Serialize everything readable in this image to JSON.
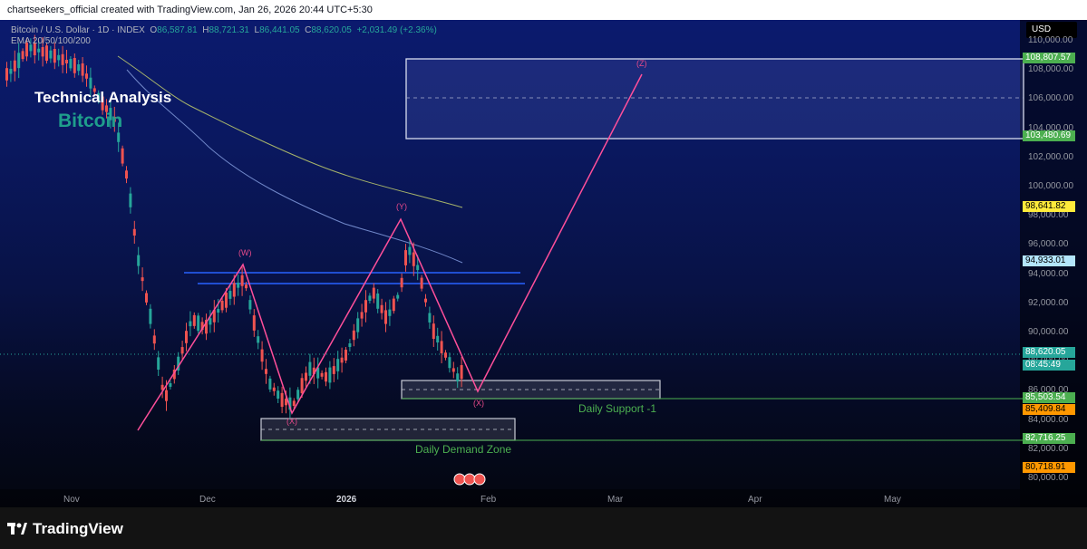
{
  "header": {
    "title": "chartseekers_official created with TradingView.com, Jan 26, 2026 20:44 UTC+5:30"
  },
  "legend": {
    "symbol": "Bitcoin / U.S. Dollar · 1D · INDEX",
    "open_label": "O",
    "open": "86,587.81",
    "high_label": "H",
    "high": "88,721.31",
    "low_label": "L",
    "low": "86,441.05",
    "close_label": "C",
    "close": "88,620.05",
    "change": "+2,031.49 (+2.36%)",
    "indicator": "EMA 20/50/100/200"
  },
  "overlay": {
    "title": "Technical Analysis",
    "subtitle": "Bitcoin"
  },
  "currency": "USD",
  "price_axis": [
    {
      "label": "110,000.00",
      "value": 110000
    },
    {
      "label": "108,000.00",
      "value": 108000
    },
    {
      "label": "106,000.00",
      "value": 106000
    },
    {
      "label": "104,000.00",
      "value": 104000
    },
    {
      "label": "102,000.00",
      "value": 102000
    },
    {
      "label": "100,000.00",
      "value": 100000
    },
    {
      "label": "98,000.00",
      "value": 98000
    },
    {
      "label": "96,000.00",
      "value": 96000
    },
    {
      "label": "94,000.00",
      "value": 94000
    },
    {
      "label": "92,000.00",
      "value": 92000
    },
    {
      "label": "90,000.00",
      "value": 90000
    },
    {
      "label": "88,000.00",
      "value": 88000
    },
    {
      "label": "86,000.00",
      "value": 86000
    },
    {
      "label": "84,000.00",
      "value": 84000
    },
    {
      "label": "82,000.00",
      "value": 82000
    },
    {
      "label": "80,000.00",
      "value": 80000
    }
  ],
  "price_tags": [
    {
      "label": "108,807.57",
      "value": 108807.57,
      "bg": "#4caf50",
      "fg": "#ffffff"
    },
    {
      "label": "103,480.69",
      "value": 103480.69,
      "bg": "#4caf50",
      "fg": "#ffffff"
    },
    {
      "label": "98,641.82",
      "value": 98641.82,
      "bg": "#ffeb3b",
      "fg": "#000000"
    },
    {
      "label": "94,933.01",
      "value": 94933.01,
      "bg": "#b3e5fc",
      "fg": "#000000"
    },
    {
      "label": "88,620.05",
      "value": 88620.05,
      "bg": "#26a69a",
      "fg": "#ffffff"
    },
    {
      "label": "08:45:49",
      "value": 87770,
      "bg": "#26a69a",
      "fg": "#ffffff"
    },
    {
      "label": "85,503.54",
      "value": 85503.54,
      "bg": "#4caf50",
      "fg": "#ffffff"
    },
    {
      "label": "85,409.84",
      "value": 84730,
      "bg": "#ff9800",
      "fg": "#000000"
    },
    {
      "label": "82,716.25",
      "value": 82716.25,
      "bg": "#4caf50",
      "fg": "#ffffff"
    },
    {
      "label": "80,718.91",
      "value": 80718.91,
      "bg": "#ff9800",
      "fg": "#000000"
    }
  ],
  "time_axis": [
    {
      "label": "Nov",
      "bold": false
    },
    {
      "label": "Dec",
      "bold": false
    },
    {
      "label": "2026",
      "bold": true
    },
    {
      "label": "Feb",
      "bold": false
    },
    {
      "label": "Mar",
      "bold": false
    },
    {
      "label": "Apr",
      "bold": false
    },
    {
      "label": "May",
      "bold": false
    }
  ],
  "annotations": {
    "daily_support": "Daily Support -1",
    "daily_demand": "Daily Demand Zone",
    "waves": [
      "W",
      "X",
      "Y",
      "X",
      "Z"
    ]
  },
  "colors": {
    "up": "#26a69a",
    "down": "#ef5350",
    "zone_line": "#4caf50",
    "wave": "#ff4f9a",
    "resistance": "#2962ff"
  },
  "brand": "TradingView",
  "icons": [
    "tradingview-logo-icon",
    "event-flags-icon"
  ]
}
